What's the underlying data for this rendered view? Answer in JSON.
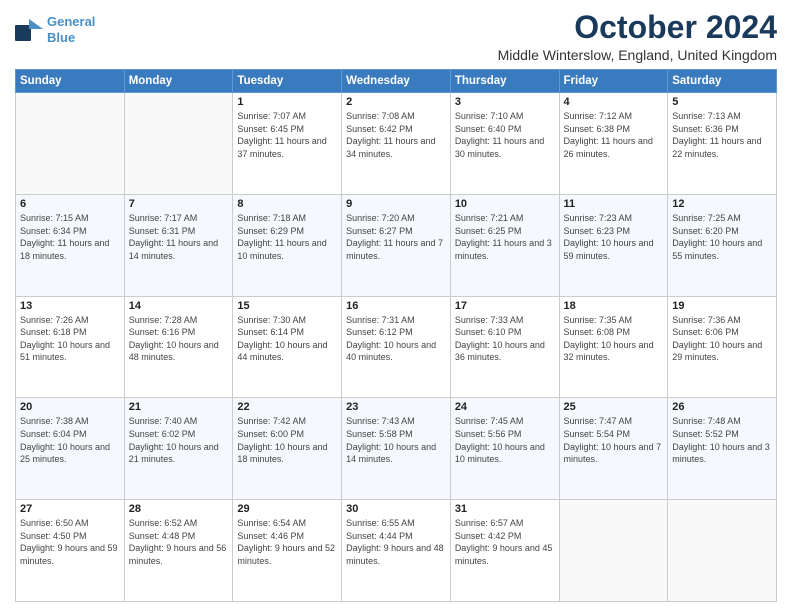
{
  "header": {
    "logo_line1": "General",
    "logo_line2": "Blue",
    "month_title": "October 2024",
    "subtitle": "Middle Winterslow, England, United Kingdom"
  },
  "days_of_week": [
    "Sunday",
    "Monday",
    "Tuesday",
    "Wednesday",
    "Thursday",
    "Friday",
    "Saturday"
  ],
  "weeks": [
    [
      {
        "day": "",
        "info": ""
      },
      {
        "day": "",
        "info": ""
      },
      {
        "day": "1",
        "info": "Sunrise: 7:07 AM\nSunset: 6:45 PM\nDaylight: 11 hours and 37 minutes."
      },
      {
        "day": "2",
        "info": "Sunrise: 7:08 AM\nSunset: 6:42 PM\nDaylight: 11 hours and 34 minutes."
      },
      {
        "day": "3",
        "info": "Sunrise: 7:10 AM\nSunset: 6:40 PM\nDaylight: 11 hours and 30 minutes."
      },
      {
        "day": "4",
        "info": "Sunrise: 7:12 AM\nSunset: 6:38 PM\nDaylight: 11 hours and 26 minutes."
      },
      {
        "day": "5",
        "info": "Sunrise: 7:13 AM\nSunset: 6:36 PM\nDaylight: 11 hours and 22 minutes."
      }
    ],
    [
      {
        "day": "6",
        "info": "Sunrise: 7:15 AM\nSunset: 6:34 PM\nDaylight: 11 hours and 18 minutes."
      },
      {
        "day": "7",
        "info": "Sunrise: 7:17 AM\nSunset: 6:31 PM\nDaylight: 11 hours and 14 minutes."
      },
      {
        "day": "8",
        "info": "Sunrise: 7:18 AM\nSunset: 6:29 PM\nDaylight: 11 hours and 10 minutes."
      },
      {
        "day": "9",
        "info": "Sunrise: 7:20 AM\nSunset: 6:27 PM\nDaylight: 11 hours and 7 minutes."
      },
      {
        "day": "10",
        "info": "Sunrise: 7:21 AM\nSunset: 6:25 PM\nDaylight: 11 hours and 3 minutes."
      },
      {
        "day": "11",
        "info": "Sunrise: 7:23 AM\nSunset: 6:23 PM\nDaylight: 10 hours and 59 minutes."
      },
      {
        "day": "12",
        "info": "Sunrise: 7:25 AM\nSunset: 6:20 PM\nDaylight: 10 hours and 55 minutes."
      }
    ],
    [
      {
        "day": "13",
        "info": "Sunrise: 7:26 AM\nSunset: 6:18 PM\nDaylight: 10 hours and 51 minutes."
      },
      {
        "day": "14",
        "info": "Sunrise: 7:28 AM\nSunset: 6:16 PM\nDaylight: 10 hours and 48 minutes."
      },
      {
        "day": "15",
        "info": "Sunrise: 7:30 AM\nSunset: 6:14 PM\nDaylight: 10 hours and 44 minutes."
      },
      {
        "day": "16",
        "info": "Sunrise: 7:31 AM\nSunset: 6:12 PM\nDaylight: 10 hours and 40 minutes."
      },
      {
        "day": "17",
        "info": "Sunrise: 7:33 AM\nSunset: 6:10 PM\nDaylight: 10 hours and 36 minutes."
      },
      {
        "day": "18",
        "info": "Sunrise: 7:35 AM\nSunset: 6:08 PM\nDaylight: 10 hours and 32 minutes."
      },
      {
        "day": "19",
        "info": "Sunrise: 7:36 AM\nSunset: 6:06 PM\nDaylight: 10 hours and 29 minutes."
      }
    ],
    [
      {
        "day": "20",
        "info": "Sunrise: 7:38 AM\nSunset: 6:04 PM\nDaylight: 10 hours and 25 minutes."
      },
      {
        "day": "21",
        "info": "Sunrise: 7:40 AM\nSunset: 6:02 PM\nDaylight: 10 hours and 21 minutes."
      },
      {
        "day": "22",
        "info": "Sunrise: 7:42 AM\nSunset: 6:00 PM\nDaylight: 10 hours and 18 minutes."
      },
      {
        "day": "23",
        "info": "Sunrise: 7:43 AM\nSunset: 5:58 PM\nDaylight: 10 hours and 14 minutes."
      },
      {
        "day": "24",
        "info": "Sunrise: 7:45 AM\nSunset: 5:56 PM\nDaylight: 10 hours and 10 minutes."
      },
      {
        "day": "25",
        "info": "Sunrise: 7:47 AM\nSunset: 5:54 PM\nDaylight: 10 hours and 7 minutes."
      },
      {
        "day": "26",
        "info": "Sunrise: 7:48 AM\nSunset: 5:52 PM\nDaylight: 10 hours and 3 minutes."
      }
    ],
    [
      {
        "day": "27",
        "info": "Sunrise: 6:50 AM\nSunset: 4:50 PM\nDaylight: 9 hours and 59 minutes."
      },
      {
        "day": "28",
        "info": "Sunrise: 6:52 AM\nSunset: 4:48 PM\nDaylight: 9 hours and 56 minutes."
      },
      {
        "day": "29",
        "info": "Sunrise: 6:54 AM\nSunset: 4:46 PM\nDaylight: 9 hours and 52 minutes."
      },
      {
        "day": "30",
        "info": "Sunrise: 6:55 AM\nSunset: 4:44 PM\nDaylight: 9 hours and 48 minutes."
      },
      {
        "day": "31",
        "info": "Sunrise: 6:57 AM\nSunset: 4:42 PM\nDaylight: 9 hours and 45 minutes."
      },
      {
        "day": "",
        "info": ""
      },
      {
        "day": "",
        "info": ""
      }
    ]
  ]
}
